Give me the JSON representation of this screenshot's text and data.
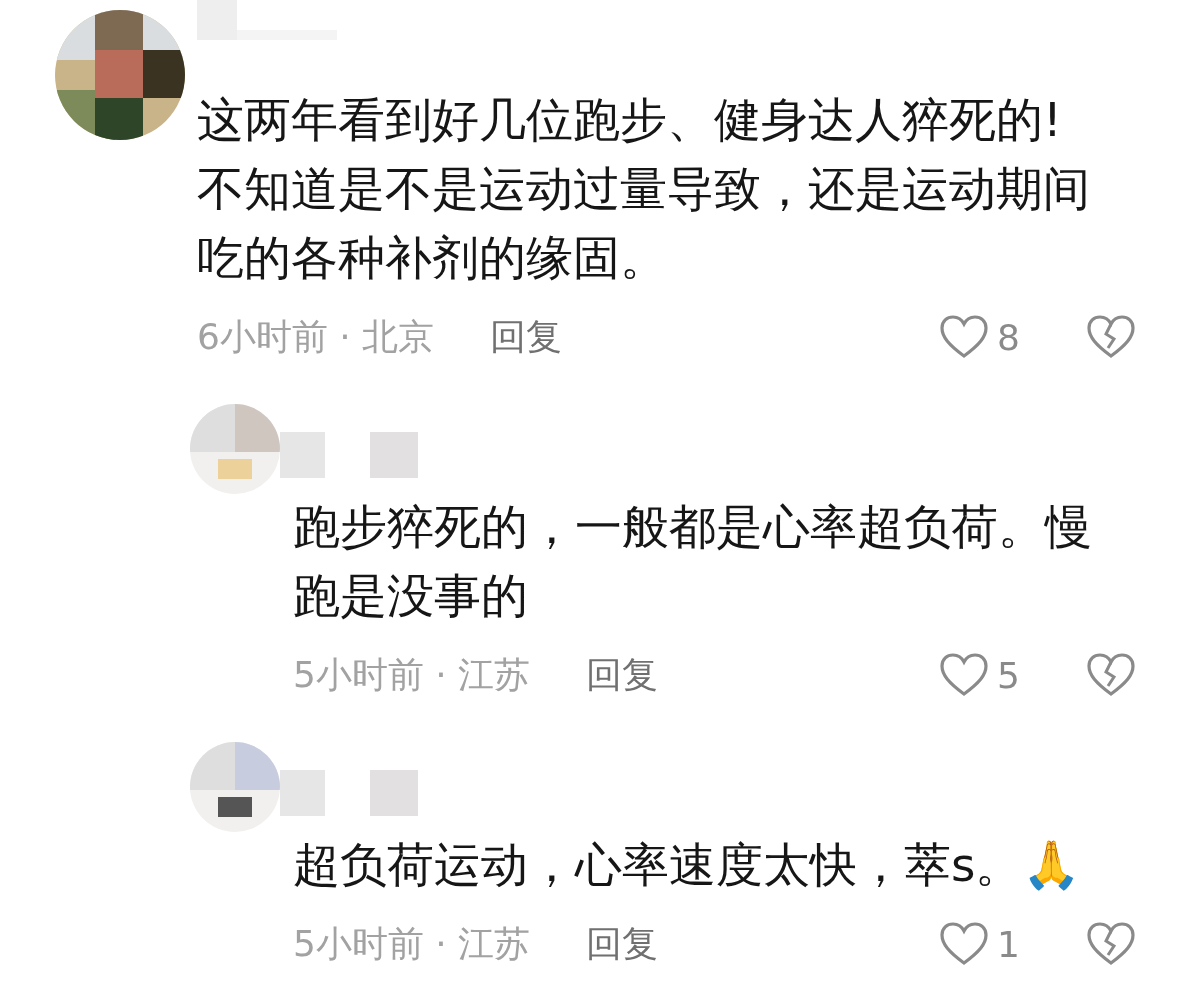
{
  "comments": [
    {
      "text_lines": [
        "这两年看到好几位跑步、健身达人猝死的!",
        "不知道是不是运动过量导致，还是运动期间",
        "吃的各种补剂的缘固。"
      ],
      "meta": "6小时前 · 北京",
      "reply": "回复",
      "liked": false,
      "likes": "8",
      "replies": [
        {
          "text_lines": [
            "跑步猝死的，一般都是心率超负荷。慢",
            "跑是没事的"
          ],
          "meta": "5小时前 · 江苏",
          "reply": "回复",
          "liked": false,
          "likes": "5"
        },
        {
          "text_lines": [
            "超负荷运动，心率速度太快，萃s。🙏"
          ],
          "meta": "5小时前 · 江苏",
          "reply": "回复",
          "liked": false,
          "likes": "1"
        }
      ]
    }
  ]
}
